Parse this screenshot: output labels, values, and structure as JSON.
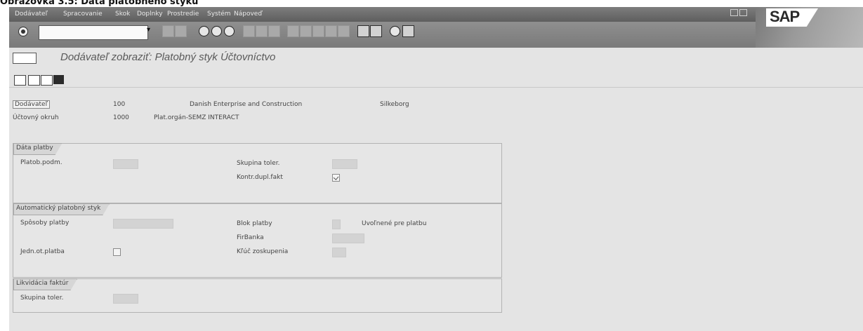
{
  "caption": "Obrazovka 3.5: Dáta platobného styku",
  "menu": [
    "Dodávateľ",
    "Spracovanie",
    "Skok",
    "Doplnky",
    "Prostredie",
    "Systém",
    "Nápoveď"
  ],
  "logo": "SAP",
  "title": "Dodávateľ zobraziť: Platobný styk Účtovníctvo",
  "header": {
    "vendor_label": "Dodávateľ",
    "vendor_number": "100",
    "vendor_name": "Danish Enterprise and Construction",
    "vendor_city": "Silkeborg",
    "company_code_label": "Účtovný okruh",
    "company_code": "1000",
    "company_name": "Plat.orgán-SEMZ INTERACT"
  },
  "groups": {
    "payment_data": {
      "tab": "Dáta platby",
      "terms_label": "Platob.podm.",
      "tolerance_group_label": "Skupina toler.",
      "double_invoice_label": "Kontr.dupl.fakt"
    },
    "auto_payment": {
      "tab": "Automatický platobný styk",
      "methods_label": "Spôsoby platby",
      "block_label": "Blok platby",
      "block_desc": "Uvoľnené pre platbu",
      "house_bank_label": "FirBanka",
      "individual_label": "Jedn.ot.platba",
      "grouping_key_label": "Kľúč zoskupenia"
    },
    "clearing": {
      "tab": "Likvidácia faktúr",
      "tolerance_group_label": "Skupina toler."
    }
  }
}
